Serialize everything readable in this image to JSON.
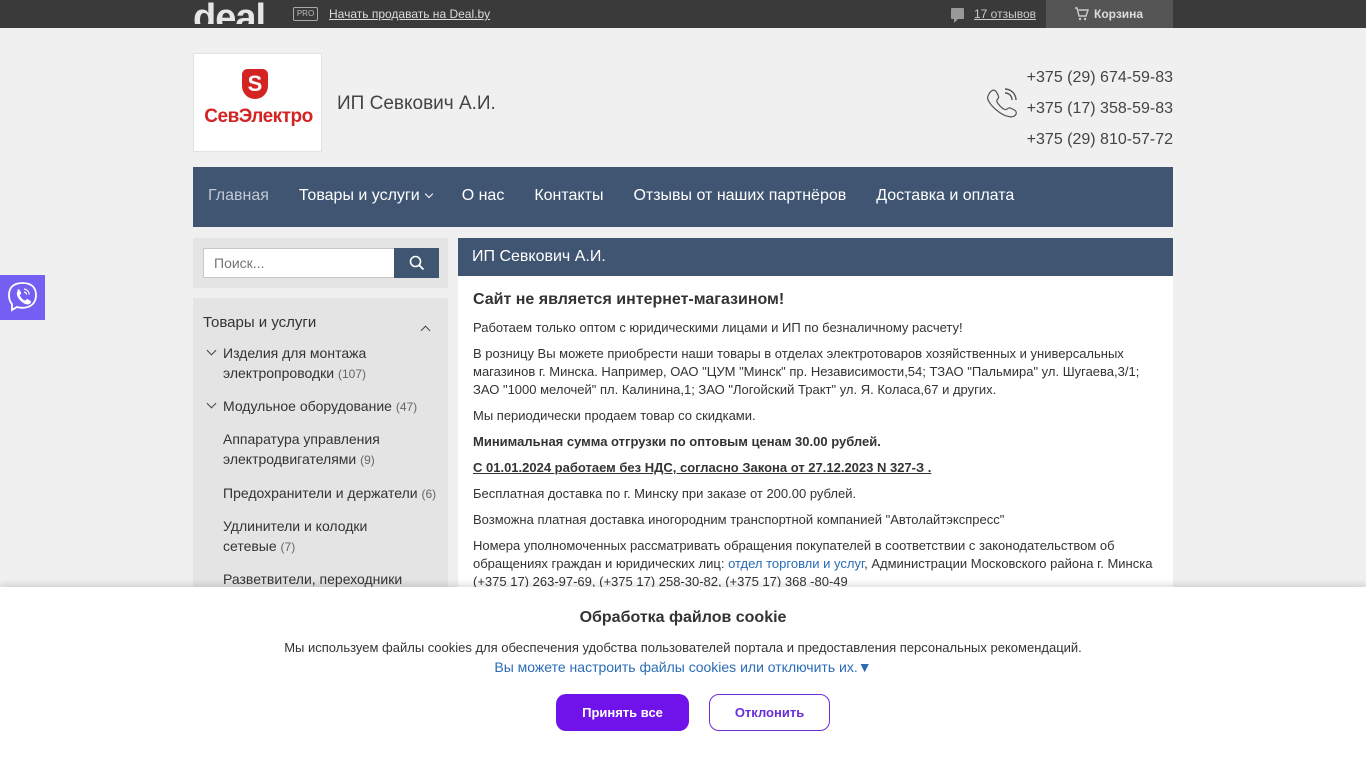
{
  "topbar": {
    "logo": "deal",
    "pro_badge": "PRO",
    "sell_link": "Начать продавать на Deal.by",
    "reviews": "17 отзывов",
    "cart": "Корзина"
  },
  "header": {
    "logo_letter": "S",
    "logo_text": "СевЭлектро",
    "company_name": "ИП Севкович А.И.",
    "phones": [
      "+375 (29) 674-59-83",
      "+375 (17) 358-59-83",
      "+375 (29) 810-57-72"
    ]
  },
  "nav": {
    "items": [
      "Главная",
      "Товары и услуги",
      "О нас",
      "Контакты",
      "Отзывы от наших партнёров",
      "Доставка и оплата"
    ]
  },
  "search": {
    "placeholder": "Поиск..."
  },
  "sidebar": {
    "title": "Товары и услуги",
    "items": [
      {
        "label": "Изделия для монтажа электропроводки",
        "count": "(107)"
      },
      {
        "label": "Модульное оборудование",
        "count": "(47)"
      },
      {
        "label": "Аппаратура управления электродвигателями",
        "count": "(9)"
      },
      {
        "label": "Предохранители и держатели",
        "count": "(6)"
      },
      {
        "label": "Удлинители и колодки сетевые",
        "count": "(7)"
      },
      {
        "label": "Разветвители, переходники",
        "count": ""
      }
    ]
  },
  "main": {
    "title": "ИП Севкович А.И.",
    "headline": "Сайт не является интернет-магазином!",
    "p1": "Работаем только оптом с юридическими лицами и ИП по безналичному расчету!",
    "p2": "В розницу Вы можете приобрести наши товары в отделах электротоваров хозяйственных и универсальных магазинов г. Минска. Например, ОАО \"ЦУМ \"Минск\" пр. Независимости,54; ТЗАО \"Пальмира\" ул. Шугаева,3/1; ЗАО \"1000 мелочей\" пл. Калинина,1; ЗАО \"Логойский Тракт\"  ул. Я. Коласа,67 и других.",
    "p3": "Мы периодически продаем товар со скидками.",
    "p4": "Минимальная сумма отгрузки по оптовым ценам 30.00 рублей.",
    "p5": "С 01.01.2024  работаем без НДС, согласно Закона от 27.12.2023 N 327-З .",
    "p6": "Бесплатная доставка по г. Минску при заказе от 200.00 рублей.",
    "p7": "Возможна платная доставка иногородним транспортной компанией \"Автолайтэкспресс\"",
    "p8_start": "Номера уполномоченных рассматривать обращения покупателей в соответствии с законодательством об обращениях граждан и юридических лиц: ",
    "p8_link": "отдел торговли и услуг",
    "p8_end": ", Администрации Московского района г. Минска (+375 17) 263-97-69, (+375 17) 258-30-82, (+375 17) 368 -80-49"
  },
  "cookie": {
    "title": "Обработка файлов cookie",
    "text": "Мы используем файлы cookies для обеспечения удобства пользователей портала и предоставления персональных рекомендаций.",
    "link": "Вы можете настроить файлы cookies или отключить их.▼",
    "accept": "Принять все",
    "decline": "Отклонить"
  }
}
